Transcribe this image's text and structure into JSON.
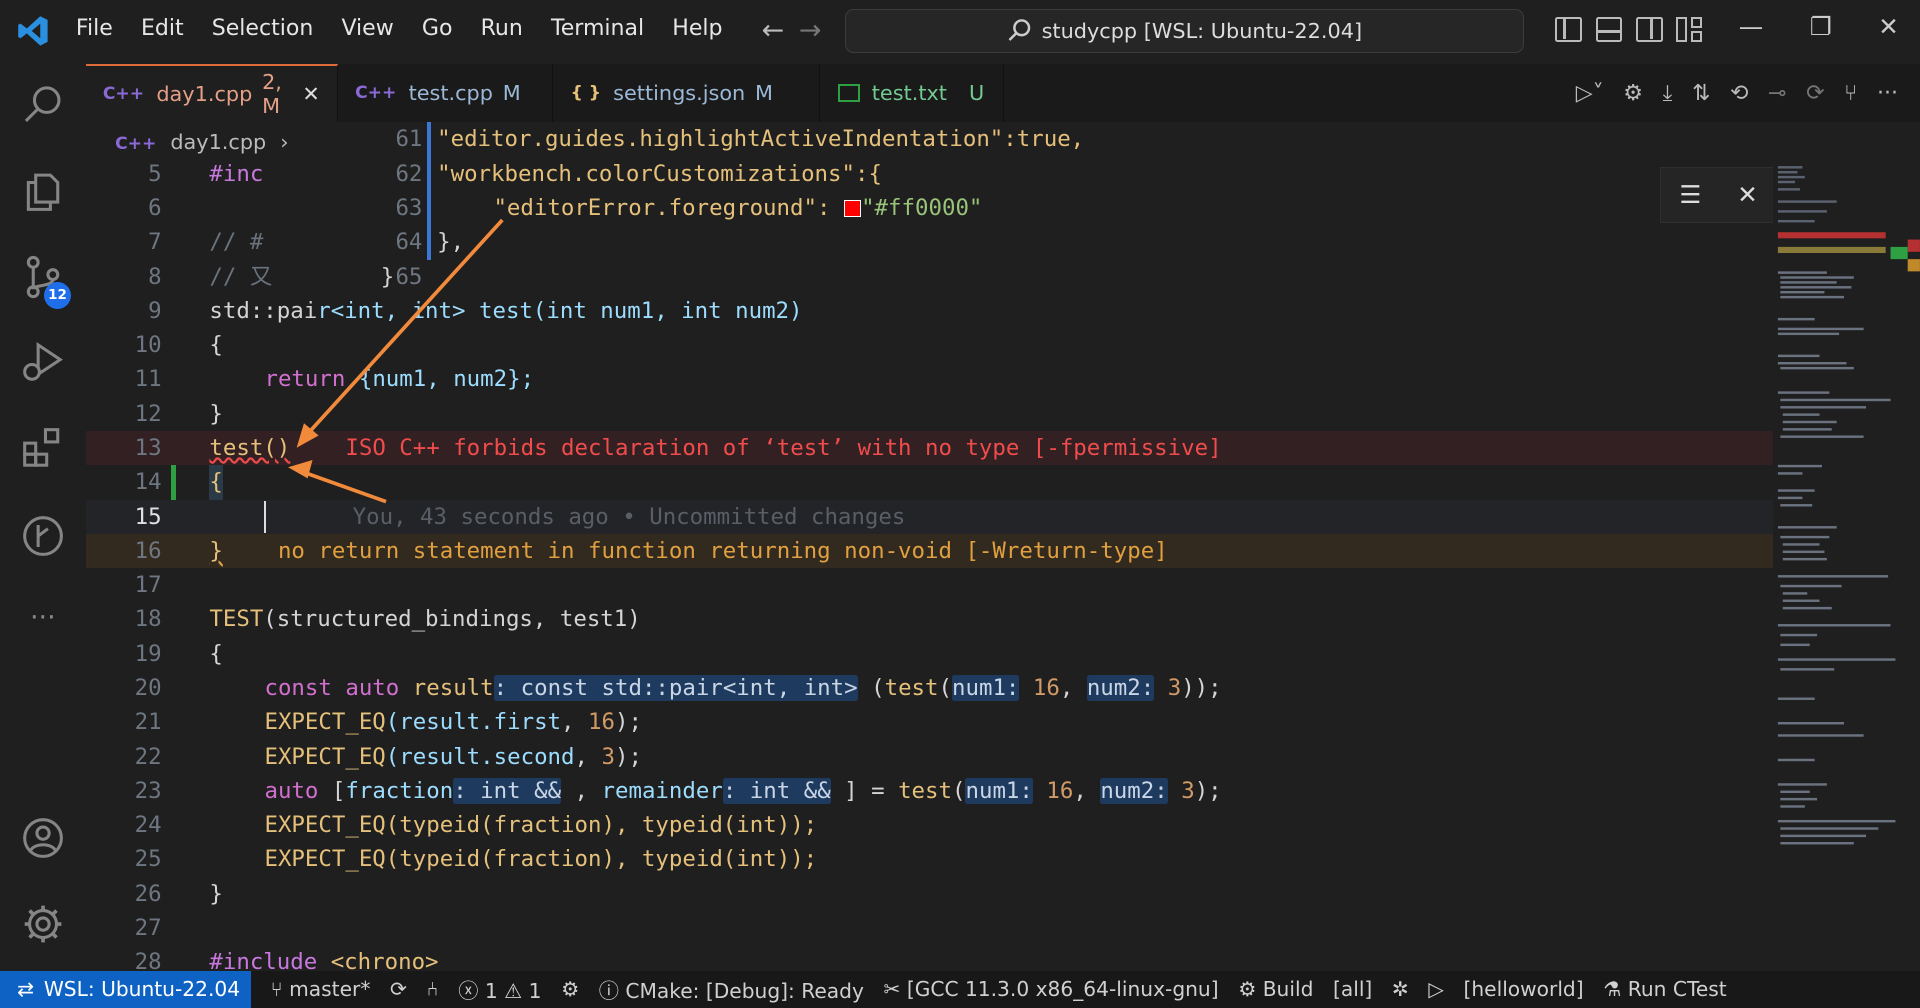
{
  "titlebar": {
    "menu": [
      "File",
      "Edit",
      "Selection",
      "View",
      "Go",
      "Run",
      "Terminal",
      "Help"
    ],
    "command_center": "studycpp [WSL: Ubuntu-22.04]"
  },
  "activity": {
    "scm_badge": "12"
  },
  "tabs": [
    {
      "icon": "C++",
      "label": "day1.cpp",
      "status": "2, M",
      "active": true
    },
    {
      "icon": "C++",
      "label": "test.cpp",
      "status": "M",
      "active": false
    },
    {
      "icon": "{ }",
      "label": "settings.json",
      "status": "M",
      "active": false
    },
    {
      "icon": "txt",
      "label": "test.txt",
      "status": "U",
      "active": false
    }
  ],
  "breadcrumb": {
    "file": "day1.cpp"
  },
  "peek": {
    "lines": [
      {
        "n": "61",
        "t": "\"editor.guides.highlightActiveIndentation\":true,"
      },
      {
        "n": "62",
        "t": "\"workbench.colorCustomizations\":{"
      },
      {
        "n": "63",
        "k": "\"editorError.foreground\":",
        "v": "\"#ff0000\""
      },
      {
        "n": "64",
        "t": "},"
      },
      {
        "n": "65",
        "t": "}"
      }
    ],
    "swatch_color": "#ff0000"
  },
  "editor": {
    "ln5": "5",
    "ln6": "6",
    "ln7": "7",
    "ln8": "8",
    "ln9": "9",
    "ln10": "10",
    "ln11": "11",
    "ln12": "12",
    "ln13": "13",
    "ln14": "14",
    "ln15": "15",
    "ln16": "16",
    "ln17": "17",
    "ln18": "18",
    "ln19": "19",
    "ln20": "20",
    "ln21": "21",
    "ln22": "22",
    "ln23": "23",
    "ln24": "24",
    "ln25": "25",
    "ln26": "26",
    "ln27": "27",
    "ln28": "28",
    "l5": "#inc",
    "l7": "// #",
    "l8": "// 又",
    "l9a": "std::pai",
    "l9b": "r<int, int> test(int num1, int num2)",
    "l10": "{",
    "l11a": "return",
    "l11b": " {num1, num2};",
    "l12": "}",
    "l13": "test()",
    "err13": "ISO C++ forbids declaration of ‘test’ with no type [-fpermissive]",
    "l14": "{",
    "blame15": "You, 43 seconds ago • Uncommitted changes",
    "l16": "}",
    "warn16": "no return statement in function returning non-void [-Wreturn-type]",
    "l18a": "TEST",
    "l18b": "(structured_bindings, test1)",
    "l19": "{",
    "l20": {
      "kw": "const auto",
      "var": "result",
      "hint": ": const std::pair<int, int>",
      "rest1": " (",
      "fn": "test",
      "p1": "(",
      "h1": "num1:",
      "n1": " 16",
      ", ": ", ",
      "h2": "num2:",
      "n2": " 3",
      "end": "));"
    },
    "l21": {
      "m": "EXPECT_EQ",
      "a": "(result.",
      "f": "first",
      ",": ", ",
      "n": "16",
      "e": ");"
    },
    "l22": {
      "m": "EXPECT_EQ",
      "a": "(result.",
      "f": "second",
      ",": ", ",
      "n": "3",
      "e": ");"
    },
    "l23": {
      "kw": "auto",
      "b": " [",
      "v1": "fraction",
      "h1": ": int &&",
      "c": " , ",
      "v2": "remainder",
      "h2": ": int &&",
      "e": " ] = ",
      "fn": "test",
      "p": "(",
      "hn1": "num1:",
      "n1": " 16",
      ",": ", ",
      "hn2": "num2:",
      "n2": " 3",
      "end": ");"
    },
    "l24": "EXPECT_EQ(typeid(fraction), typeid(int));",
    "l25": "EXPECT_EQ(typeid(fraction), typeid(int));",
    "l26": "}",
    "l28a": "#include",
    "l28b": " <chrono>"
  },
  "statusbar": {
    "remote": "WSL: Ubuntu-22.04",
    "branch": "master*",
    "errors": "1",
    "warnings": "1",
    "cmake": "CMake: [Debug]: Ready",
    "kit": "[GCC 11.3.0 x86_64-linux-gnu]",
    "build": "Build",
    "target": "[all]",
    "launch": "[helloworld]",
    "ctest": "Run CTest"
  },
  "colors": {
    "accent": "#0e62c4",
    "error": "#f14c4c",
    "warning": "#e0a040",
    "tab_active": "#e06b3a",
    "annotation_arrow": "#f28a3c"
  }
}
